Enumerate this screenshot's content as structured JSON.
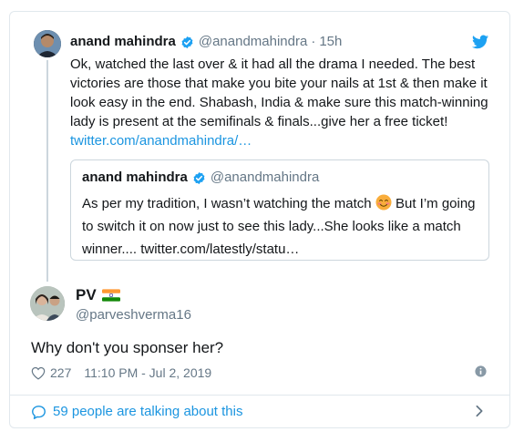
{
  "parent_tweet": {
    "author_name": "anand mahindra",
    "author_handle": "@anandmahindra",
    "separator": "·",
    "time": "15h",
    "text": "Ok, watched the last over & it had all the drama I needed. The best victories are those that make you bite your nails at 1st & then make it look easy in the end. Shabash, India & make sure this match-winning lady is present at the semifinals & finals...give her a free ticket! ",
    "link": "twitter.com/anandmahindra/…"
  },
  "quoted_tweet": {
    "author_name": "anand mahindra",
    "author_handle": "@anandmahindra",
    "text_before_emoji": "As per my tradition, I wasn’t watching the match ",
    "text_after_emoji": " But I’m going to switch it on now just to see this lady...She looks like a match winner.... twitter.com/latestly/statu…"
  },
  "reply_tweet": {
    "author_name": "PV",
    "author_handle": "@parveshverma16",
    "text": "Why don't you sponser her?",
    "likes": "227",
    "timestamp": "11:10 PM - Jul 2, 2019"
  },
  "footer": {
    "talking_text": "59 people are talking about this"
  },
  "colors": {
    "link": "#1b95e0",
    "verified": "#1da1f2",
    "muted": "#657786",
    "border": "#e1e8ed"
  },
  "icons": [
    "verified-badge-icon",
    "twitter-bird-icon",
    "smiling-emoji-icon",
    "india-flag-icon",
    "heart-icon",
    "info-icon",
    "speech-bubble-icon",
    "chevron-right-icon"
  ]
}
